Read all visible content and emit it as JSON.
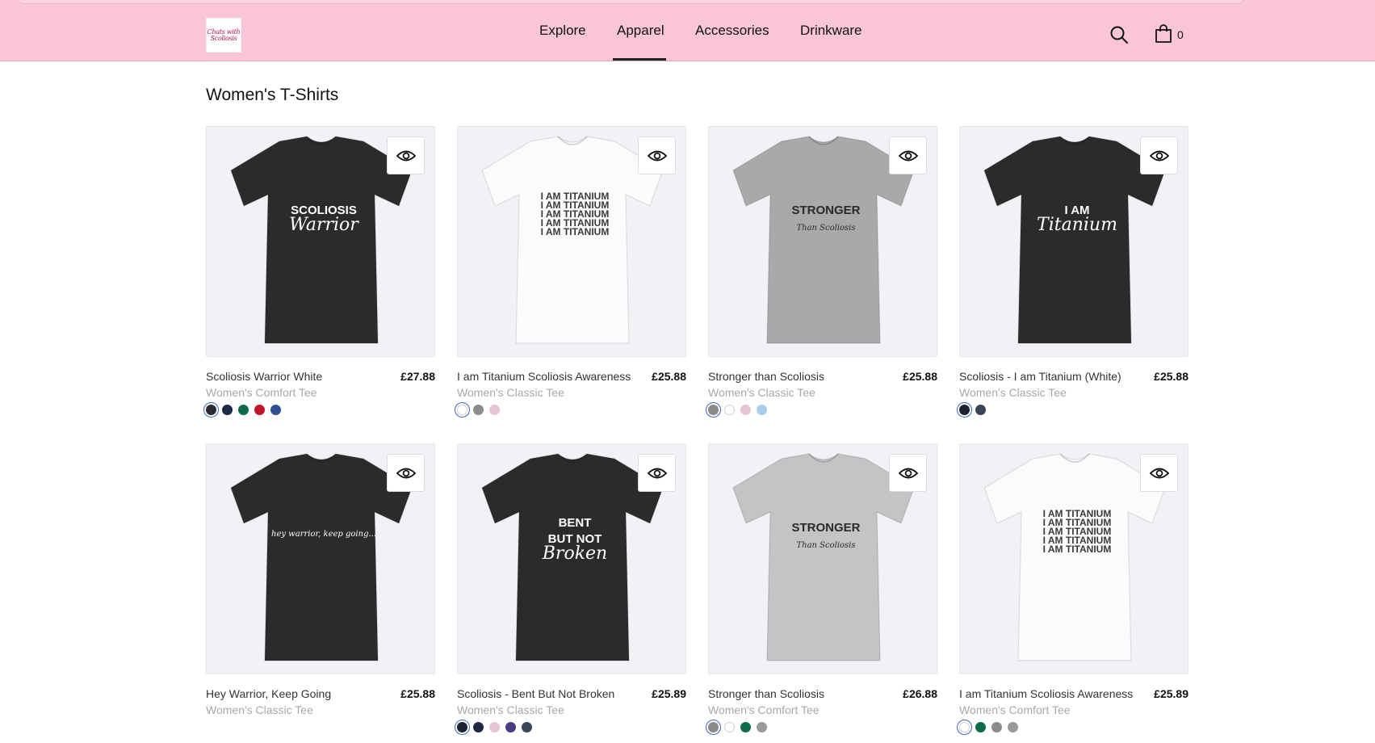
{
  "header": {
    "logo_icon": "brand-logo",
    "logo_lines": [
      "Chats with",
      "Scoliosis"
    ],
    "nav": [
      {
        "label": "Explore",
        "active": false
      },
      {
        "label": "Apparel",
        "active": true
      },
      {
        "label": "Accessories",
        "active": false
      },
      {
        "label": "Drinkware",
        "active": false
      }
    ],
    "search_icon": "search-icon",
    "cart_icon": "shopping-bag-icon",
    "cart_count": "0"
  },
  "page": {
    "title": "Women's T-Shirts"
  },
  "colors": {
    "header_bg": "#f9c5d7",
    "nav_underline": "#222222",
    "swatch_selected_ring": "#3864c8"
  },
  "products": [
    {
      "name": "Scoliosis Warrior White",
      "price": "£27.88",
      "subtitle": "Women's Comfort Tee",
      "shirt_color": "#2b2b2b",
      "print_color": "#ffffff",
      "print_lines": [
        "SCOLIOSIS",
        "Warrior"
      ],
      "swatches": [
        "#2b2b35",
        "#1e2a45",
        "#0e6b4d",
        "#c0172b",
        "#2e4f93"
      ],
      "selected": 0
    },
    {
      "name": "I am Titanium Scoliosis Awareness",
      "price": "£25.88",
      "subtitle": "Women's Classic Tee",
      "shirt_color": "#fbfbfb",
      "print_color": "#3a3a3a",
      "print_lines": [
        "I AM TITANIUM",
        "I AM TITANIUM",
        "I AM TITANIUM",
        "I AM TITANIUM",
        "I AM TITANIUM"
      ],
      "swatches": [
        "#ffffff",
        "#8c8c8c",
        "#e7c4d4"
      ],
      "selected": 0
    },
    {
      "name": "Stronger than Scoliosis",
      "price": "£25.88",
      "subtitle": "Women's Classic Tee",
      "shirt_color": "#a9a9a9",
      "print_color": "#2a2a2a",
      "print_lines": [
        "STRONGER",
        "Than Scoliosis"
      ],
      "swatches": [
        "#8a8a8a",
        "#ffffff",
        "#e7c4d4",
        "#a9cde9"
      ],
      "selected": 0
    },
    {
      "name": "Scoliosis - I am Titanium (White)",
      "price": "£25.88",
      "subtitle": "Women's Classic Tee",
      "shirt_color": "#2b2b2b",
      "print_color": "#ffffff",
      "print_lines": [
        "I AM",
        "Titanium"
      ],
      "swatches": [
        "#1e2233",
        "#3a4558"
      ],
      "selected": 0
    },
    {
      "name": "Hey Warrior, Keep Going",
      "price": "£25.88",
      "subtitle": "Women's Classic Tee",
      "shirt_color": "#2b2b2b",
      "print_color": "#ffffff",
      "print_lines": [
        "hey warrior, keep going..."
      ],
      "swatches": [],
      "selected": -1
    },
    {
      "name": "Scoliosis - Bent But Not Broken",
      "price": "£25.89",
      "subtitle": "Women's Classic Tee",
      "shirt_color": "#2b2b2b",
      "print_color": "#ffffff",
      "print_lines": [
        "BENT",
        "BUT NOT",
        "Broken"
      ],
      "swatches": [
        "#1e2233",
        "#1e2a45",
        "#e7c4d4",
        "#4b3a7d",
        "#3a4558"
      ],
      "selected": 0
    },
    {
      "name": "Stronger than Scoliosis",
      "price": "£26.88",
      "subtitle": "Women's Comfort Tee",
      "shirt_color": "#c4c4c4",
      "print_color": "#2a2a2a",
      "print_lines": [
        "STRONGER",
        "Than Scoliosis"
      ],
      "swatches": [
        "#8a8a8a",
        "#ffffff",
        "#0e6b4d",
        "#9a9a9a"
      ],
      "selected": 0
    },
    {
      "name": "I am Titanium Scoliosis Awareness",
      "price": "£25.89",
      "subtitle": "Women's Comfort Tee",
      "shirt_color": "#fbfbfb",
      "print_color": "#3a3a3a",
      "print_lines": [
        "I AM TITANIUM",
        "I AM TITANIUM",
        "I AM TITANIUM",
        "I AM TITANIUM",
        "I AM TITANIUM"
      ],
      "swatches": [
        "#ffffff",
        "#0e6b4d",
        "#8c8c8c",
        "#9a9a9a"
      ],
      "selected": 0
    }
  ]
}
